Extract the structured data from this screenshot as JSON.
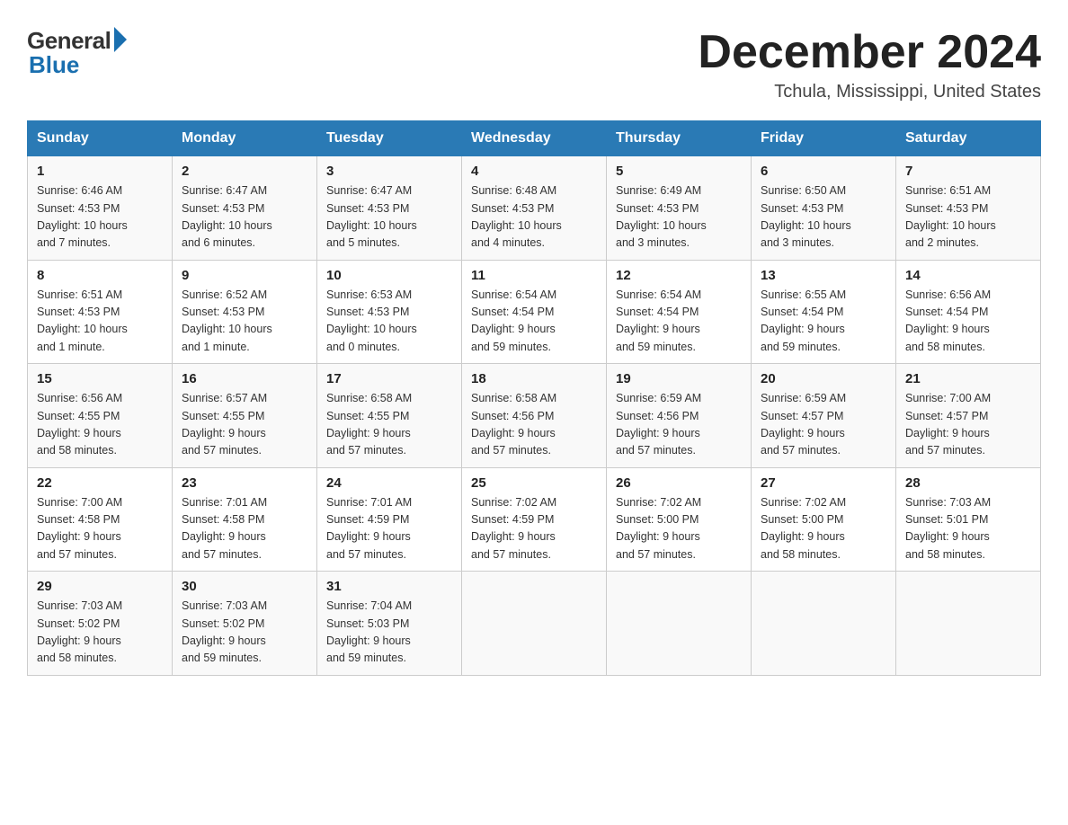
{
  "logo": {
    "general": "General",
    "blue": "Blue"
  },
  "title": "December 2024",
  "location": "Tchula, Mississippi, United States",
  "days_of_week": [
    "Sunday",
    "Monday",
    "Tuesday",
    "Wednesday",
    "Thursday",
    "Friday",
    "Saturday"
  ],
  "weeks": [
    [
      {
        "num": "1",
        "info": "Sunrise: 6:46 AM\nSunset: 4:53 PM\nDaylight: 10 hours\nand 7 minutes."
      },
      {
        "num": "2",
        "info": "Sunrise: 6:47 AM\nSunset: 4:53 PM\nDaylight: 10 hours\nand 6 minutes."
      },
      {
        "num": "3",
        "info": "Sunrise: 6:47 AM\nSunset: 4:53 PM\nDaylight: 10 hours\nand 5 minutes."
      },
      {
        "num": "4",
        "info": "Sunrise: 6:48 AM\nSunset: 4:53 PM\nDaylight: 10 hours\nand 4 minutes."
      },
      {
        "num": "5",
        "info": "Sunrise: 6:49 AM\nSunset: 4:53 PM\nDaylight: 10 hours\nand 3 minutes."
      },
      {
        "num": "6",
        "info": "Sunrise: 6:50 AM\nSunset: 4:53 PM\nDaylight: 10 hours\nand 3 minutes."
      },
      {
        "num": "7",
        "info": "Sunrise: 6:51 AM\nSunset: 4:53 PM\nDaylight: 10 hours\nand 2 minutes."
      }
    ],
    [
      {
        "num": "8",
        "info": "Sunrise: 6:51 AM\nSunset: 4:53 PM\nDaylight: 10 hours\nand 1 minute."
      },
      {
        "num": "9",
        "info": "Sunrise: 6:52 AM\nSunset: 4:53 PM\nDaylight: 10 hours\nand 1 minute."
      },
      {
        "num": "10",
        "info": "Sunrise: 6:53 AM\nSunset: 4:53 PM\nDaylight: 10 hours\nand 0 minutes."
      },
      {
        "num": "11",
        "info": "Sunrise: 6:54 AM\nSunset: 4:54 PM\nDaylight: 9 hours\nand 59 minutes."
      },
      {
        "num": "12",
        "info": "Sunrise: 6:54 AM\nSunset: 4:54 PM\nDaylight: 9 hours\nand 59 minutes."
      },
      {
        "num": "13",
        "info": "Sunrise: 6:55 AM\nSunset: 4:54 PM\nDaylight: 9 hours\nand 59 minutes."
      },
      {
        "num": "14",
        "info": "Sunrise: 6:56 AM\nSunset: 4:54 PM\nDaylight: 9 hours\nand 58 minutes."
      }
    ],
    [
      {
        "num": "15",
        "info": "Sunrise: 6:56 AM\nSunset: 4:55 PM\nDaylight: 9 hours\nand 58 minutes."
      },
      {
        "num": "16",
        "info": "Sunrise: 6:57 AM\nSunset: 4:55 PM\nDaylight: 9 hours\nand 57 minutes."
      },
      {
        "num": "17",
        "info": "Sunrise: 6:58 AM\nSunset: 4:55 PM\nDaylight: 9 hours\nand 57 minutes."
      },
      {
        "num": "18",
        "info": "Sunrise: 6:58 AM\nSunset: 4:56 PM\nDaylight: 9 hours\nand 57 minutes."
      },
      {
        "num": "19",
        "info": "Sunrise: 6:59 AM\nSunset: 4:56 PM\nDaylight: 9 hours\nand 57 minutes."
      },
      {
        "num": "20",
        "info": "Sunrise: 6:59 AM\nSunset: 4:57 PM\nDaylight: 9 hours\nand 57 minutes."
      },
      {
        "num": "21",
        "info": "Sunrise: 7:00 AM\nSunset: 4:57 PM\nDaylight: 9 hours\nand 57 minutes."
      }
    ],
    [
      {
        "num": "22",
        "info": "Sunrise: 7:00 AM\nSunset: 4:58 PM\nDaylight: 9 hours\nand 57 minutes."
      },
      {
        "num": "23",
        "info": "Sunrise: 7:01 AM\nSunset: 4:58 PM\nDaylight: 9 hours\nand 57 minutes."
      },
      {
        "num": "24",
        "info": "Sunrise: 7:01 AM\nSunset: 4:59 PM\nDaylight: 9 hours\nand 57 minutes."
      },
      {
        "num": "25",
        "info": "Sunrise: 7:02 AM\nSunset: 4:59 PM\nDaylight: 9 hours\nand 57 minutes."
      },
      {
        "num": "26",
        "info": "Sunrise: 7:02 AM\nSunset: 5:00 PM\nDaylight: 9 hours\nand 57 minutes."
      },
      {
        "num": "27",
        "info": "Sunrise: 7:02 AM\nSunset: 5:00 PM\nDaylight: 9 hours\nand 58 minutes."
      },
      {
        "num": "28",
        "info": "Sunrise: 7:03 AM\nSunset: 5:01 PM\nDaylight: 9 hours\nand 58 minutes."
      }
    ],
    [
      {
        "num": "29",
        "info": "Sunrise: 7:03 AM\nSunset: 5:02 PM\nDaylight: 9 hours\nand 58 minutes."
      },
      {
        "num": "30",
        "info": "Sunrise: 7:03 AM\nSunset: 5:02 PM\nDaylight: 9 hours\nand 59 minutes."
      },
      {
        "num": "31",
        "info": "Sunrise: 7:04 AM\nSunset: 5:03 PM\nDaylight: 9 hours\nand 59 minutes."
      },
      null,
      null,
      null,
      null
    ]
  ]
}
